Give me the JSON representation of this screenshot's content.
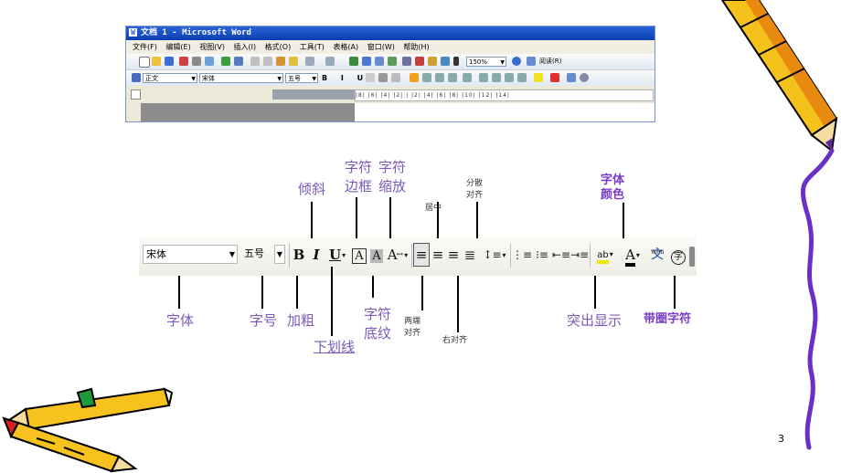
{
  "word_window": {
    "title": "文档 1 - Microsoft Word",
    "menus": [
      "文件(F)",
      "编辑(E)",
      "视图(V)",
      "插入(I)",
      "格式(O)",
      "工具(T)",
      "表格(A)",
      "窗口(W)",
      "帮助(H)"
    ],
    "zoom": "150%",
    "reading_label": "阅读(R)",
    "style_value": "正文",
    "font_value": "宋体",
    "size_value": "五号",
    "ruler_text": "|8|  |6|  |4|  |2|  |  |2|  |4|  |6|  |8|  |10|  |12|  |14|"
  },
  "toolbar": {
    "font": "宋体",
    "size": "五号",
    "bold": "B",
    "italic": "I",
    "underline": "U",
    "border": "A",
    "shading": "A",
    "scale": "A",
    "align_justify": "≡",
    "align_center": "≡",
    "align_right": "≡",
    "align_distributed": "≣",
    "line_spacing": "↕≡",
    "numbering": "⋮≡",
    "bullets": "⁝≡",
    "outdent": "⇤≡",
    "indent": "⇥≡",
    "highlight": "ab",
    "font_color": "A",
    "phonetic": "文",
    "enclose": "字"
  },
  "labels": {
    "italic": "倾斜",
    "border_line1": "字符",
    "border_line2": "边框",
    "scale_line1": "字符",
    "scale_line2": "缩放",
    "center": "居中",
    "distributed_line1": "分散",
    "distributed_line2": "对齐",
    "font_color_line1": "字体",
    "font_color_line2": "颜色",
    "font": "字体",
    "size": "字号",
    "bold": "加粗",
    "underline": "下划线",
    "shading_line1": "字符",
    "shading_line2": "底纹",
    "justify_line1": "两端",
    "justify_line2": "对齐",
    "right": "右对齐",
    "highlight": "突出显示",
    "enclose": "带圈字符"
  },
  "page_number": "3",
  "colors": {
    "label_purple": "#7b58b8",
    "bold_purple": "#7b3cc8",
    "title_blue": "#0a3fae",
    "highlight_yellow": "#f5e600",
    "font_color_red": "#e02020"
  }
}
